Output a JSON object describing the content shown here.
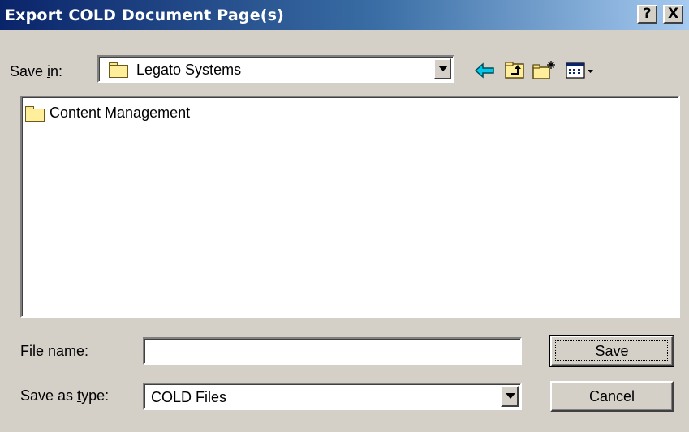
{
  "window": {
    "title": "Export COLD Document Page(s)",
    "help_button": "?",
    "close_button": "X"
  },
  "save_in": {
    "label_prefix": "Save ",
    "label_accel": "i",
    "label_suffix": "n:",
    "value": "Legato Systems"
  },
  "toolbar": {
    "icons": [
      "back-arrow-icon",
      "up-one-level-icon",
      "create-new-folder-icon",
      "view-menu-icon"
    ]
  },
  "file_list": {
    "items": [
      {
        "name": "Content Management",
        "icon": "folder-icon"
      }
    ]
  },
  "file_name": {
    "label_prefix": "File ",
    "label_accel": "n",
    "label_suffix": "ame:",
    "value": ""
  },
  "save_as_type": {
    "label_prefix": "Save as ",
    "label_accel": "t",
    "label_suffix": "ype:",
    "value": "COLD Files"
  },
  "buttons": {
    "save_accel": "S",
    "save_rest": "ave",
    "cancel": "Cancel"
  },
  "colors": {
    "titlebar_start": "#0a246a",
    "titlebar_end": "#a6caf0",
    "face": "#d4d0c8"
  }
}
